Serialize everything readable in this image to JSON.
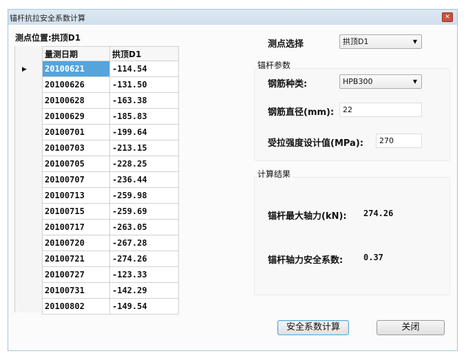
{
  "window": {
    "title": "锚杆抗拉安全系数计算",
    "close_icon": "close-icon"
  },
  "left": {
    "location_label": "测点位置:拱顶D1",
    "columns": [
      "量测日期",
      "拱顶D1"
    ],
    "rows": [
      [
        "20100621",
        "-114.54"
      ],
      [
        "20100626",
        "-131.50"
      ],
      [
        "20100628",
        "-163.38"
      ],
      [
        "20100629",
        "-185.83"
      ],
      [
        "20100701",
        "-199.64"
      ],
      [
        "20100703",
        "-213.15"
      ],
      [
        "20100705",
        "-228.25"
      ],
      [
        "20100707",
        "-236.44"
      ],
      [
        "20100713",
        "-259.98"
      ],
      [
        "20100715",
        "-259.69"
      ],
      [
        "20100717",
        "-263.05"
      ],
      [
        "20100720",
        "-267.28"
      ],
      [
        "20100721",
        "-274.26"
      ],
      [
        "20100727",
        "-123.33"
      ],
      [
        "20100731",
        "-142.29"
      ],
      [
        "20100802",
        "-149.54"
      ]
    ],
    "selected_row": 0
  },
  "right": {
    "point_select_label": "测点选择",
    "point_select_value": "拱顶D1",
    "params_group": "锚杆参数",
    "rebar_type_label": "钢筋种类:",
    "rebar_type_value": "HPB300",
    "diameter_label": "钢筋直径(mm):",
    "diameter_value": "22",
    "strength_label": "受拉强度设计值(MPa):",
    "strength_value": "270",
    "results_group": "计算结果",
    "max_force_label": "锚杆最大轴力(kN):",
    "max_force_value": "274.26",
    "safety_label": "锚杆轴力安全系数:",
    "safety_value": "0.37"
  },
  "buttons": {
    "calculate": "安全系数计算",
    "close": "关闭"
  }
}
